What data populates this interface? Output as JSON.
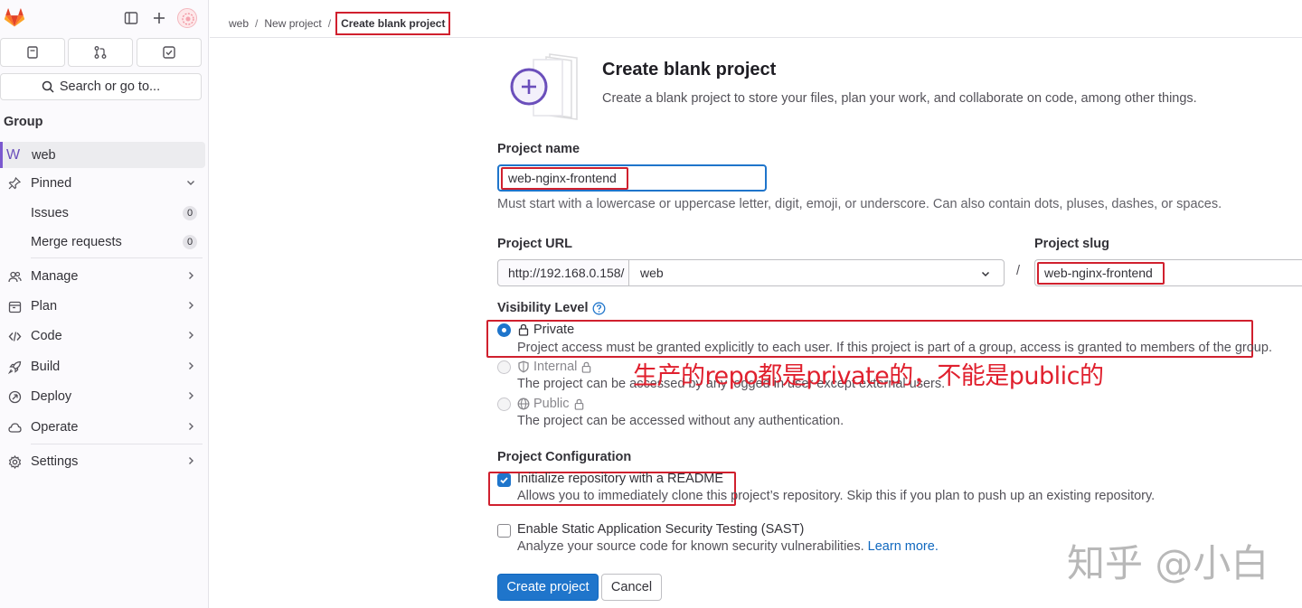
{
  "breadcrumb": {
    "items": [
      "web",
      "New project"
    ],
    "current": "Create blank project",
    "separator": "/"
  },
  "sidebar": {
    "search_label": "Search or go to...",
    "section_title": "Group",
    "group": {
      "badge": "W",
      "name": "web"
    },
    "pinned": {
      "label": "Pinned",
      "items": [
        {
          "label": "Issues",
          "count": "0"
        },
        {
          "label": "Merge requests",
          "count": "0"
        }
      ]
    },
    "items": [
      {
        "label": "Manage",
        "icon": "users-icon"
      },
      {
        "label": "Plan",
        "icon": "calendar-icon"
      },
      {
        "label": "Code",
        "icon": "code-icon"
      },
      {
        "label": "Build",
        "icon": "rocket-icon"
      },
      {
        "label": "Deploy",
        "icon": "deploy-icon"
      },
      {
        "label": "Operate",
        "icon": "cloud-icon"
      },
      {
        "label": "Settings",
        "icon": "gear-icon"
      }
    ]
  },
  "page": {
    "title": "Create blank project",
    "subtitle": "Create a blank project to store your files, plan your work, and collaborate on code, among other things."
  },
  "form": {
    "project_name": {
      "label": "Project name",
      "value": "web-nginx-frontend",
      "help": "Must start with a lowercase or uppercase letter, digit, emoji, or underscore. Can also contain dots, pluses, dashes, or spaces."
    },
    "project_url": {
      "label": "Project URL",
      "prefix": "http://192.168.0.158/",
      "namespace": "web"
    },
    "project_slug": {
      "label": "Project slug",
      "value": "web-nginx-frontend",
      "separator": "/"
    },
    "visibility": {
      "label": "Visibility Level",
      "options": [
        {
          "title": "Private",
          "desc": "Project access must be granted explicitly to each user. If this project is part of a group, access is granted to members of the group."
        },
        {
          "title": "Internal",
          "desc": "The project can be accessed by any logged in user except external users."
        },
        {
          "title": "Public",
          "desc": "The project can be accessed without any authentication."
        }
      ]
    },
    "configuration": {
      "label": "Project Configuration",
      "readme": {
        "title": "Initialize repository with a README",
        "desc": "Allows you to immediately clone this project’s repository. Skip this if you plan to push up an existing repository."
      },
      "sast": {
        "title": "Enable Static Application Security Testing (SAST)",
        "desc": "Analyze your source code for known security vulnerabilities.",
        "link": "Learn more."
      }
    },
    "buttons": {
      "create": "Create project",
      "cancel": "Cancel"
    }
  },
  "annotation": "生产的repo都是private的，不能是public的",
  "watermark": "知乎 @小白",
  "colors": {
    "primary": "#1f75cb",
    "annotation": "#d0202e",
    "sidebar_accent": "#7b58cf"
  }
}
